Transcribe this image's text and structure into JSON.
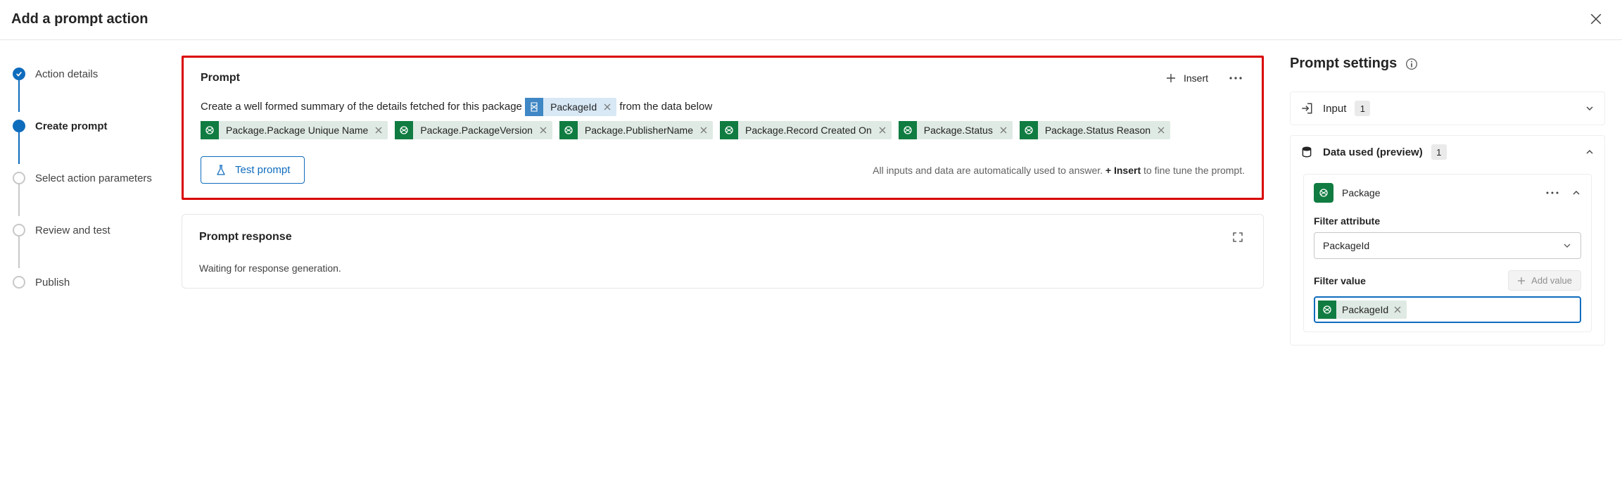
{
  "header": {
    "title": "Add a prompt action"
  },
  "nav": {
    "items": [
      {
        "label": "Action details",
        "state": "done"
      },
      {
        "label": "Create prompt",
        "state": "active"
      },
      {
        "label": "Select action parameters",
        "state": "pending"
      },
      {
        "label": "Review and test",
        "state": "pending"
      },
      {
        "label": "Publish",
        "state": "pending"
      }
    ]
  },
  "prompt": {
    "title": "Prompt",
    "insert_label": "Insert",
    "text_before": "Create a well formed summary of the details fetched for this package ",
    "inline_chip": "PackageId",
    "text_after": " from the data below",
    "chips": [
      "Package.Package Unique Name",
      "Package.PackageVersion",
      "Package.PublisherName",
      "Package.Record Created On",
      "Package.Status",
      "Package.Status Reason"
    ],
    "test_button": "Test prompt",
    "hint_pre": "All inputs and data are automatically used to answer. ",
    "hint_bold": "+ Insert",
    "hint_post": " to fine tune the prompt."
  },
  "response": {
    "title": "Prompt response",
    "waiting": "Waiting for response generation."
  },
  "settings": {
    "title": "Prompt settings",
    "input": {
      "label": "Input",
      "count": "1"
    },
    "data": {
      "label": "Data used (preview)",
      "count": "1",
      "package_label": "Package",
      "filter_attr_label": "Filter attribute",
      "filter_attr_value": "PackageId",
      "filter_value_label": "Filter value",
      "add_value_label": "Add value",
      "filter_value_chip": "PackageId"
    }
  }
}
